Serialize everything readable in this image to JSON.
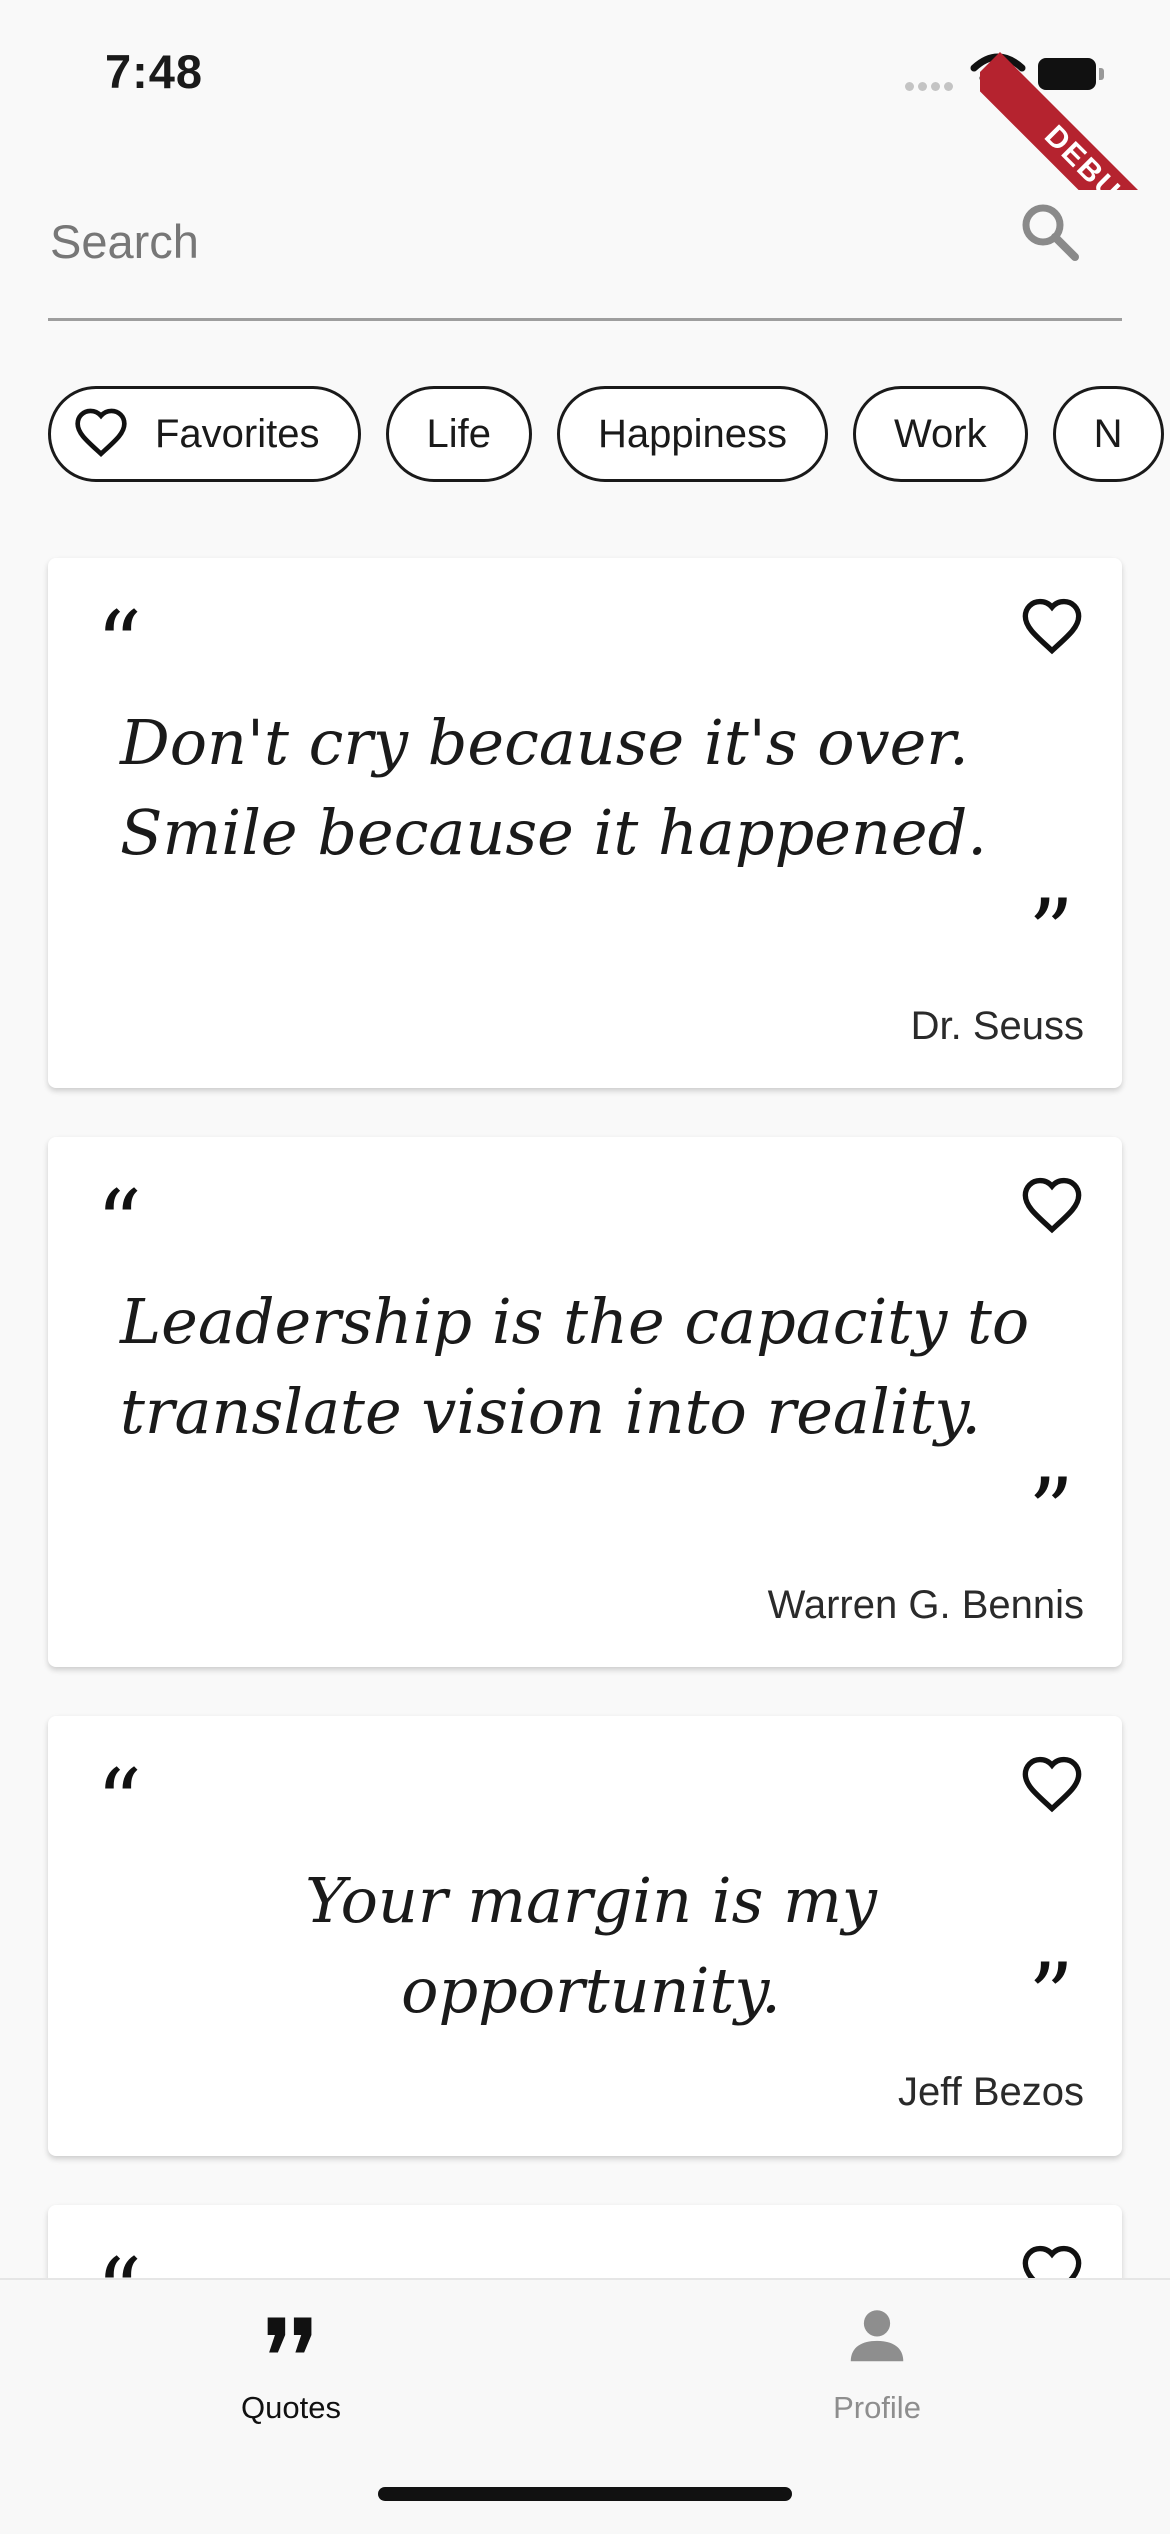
{
  "status_bar": {
    "time": "7:48",
    "debug_label": "DEBUG"
  },
  "search": {
    "placeholder": "Search"
  },
  "categories": [
    "Favorites",
    "Life",
    "Happiness",
    "Work",
    "N"
  ],
  "quotes": [
    {
      "text": "Don't cry because it's over. Smile because it happened.",
      "author": "Dr. Seuss"
    },
    {
      "text": "Leadership is the capacity to translate vision into reality.",
      "author": "Warren G. Bennis"
    },
    {
      "text": "Your margin is my opportunity.",
      "author": "Jeff Bezos"
    }
  ],
  "quote_marks": {
    "open": "“",
    "close": "”"
  },
  "nav": {
    "quotes_label": "Quotes",
    "profile_label": "Profile"
  },
  "colors": {
    "background": "#f9f9f9",
    "card": "#ffffff",
    "debug_banner": "#b5232f",
    "inactive_nav": "#8e8e8e"
  }
}
